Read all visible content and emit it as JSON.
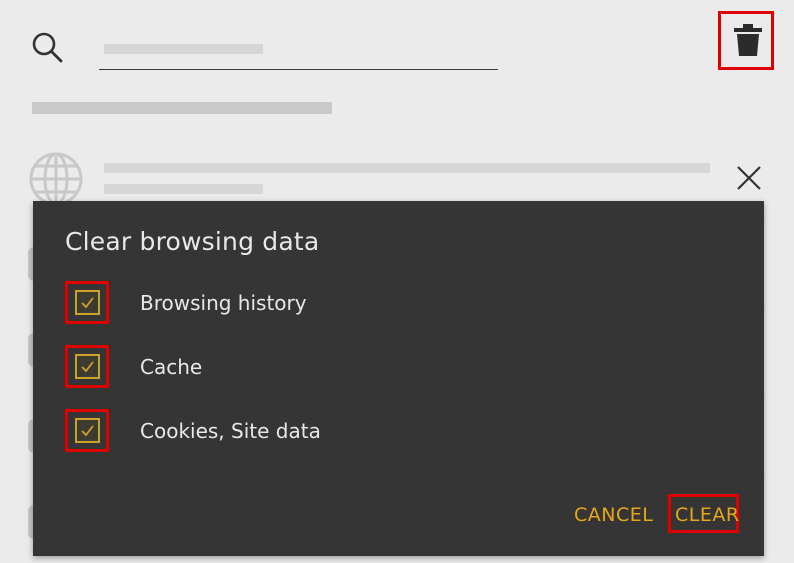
{
  "header": {
    "search_placeholder": "",
    "icons": {
      "search": "search-icon",
      "delete": "trash-icon"
    }
  },
  "history_list": {
    "first_item_icon": "globe-icon",
    "remove_icon": "close-icon"
  },
  "dialog": {
    "title": "Clear browsing data",
    "options": [
      {
        "label": "Browsing history",
        "checked": true
      },
      {
        "label": "Cache",
        "checked": true
      },
      {
        "label": "Cookies, Site data",
        "checked": true
      }
    ],
    "cancel_label": "CANCEL",
    "clear_label": "CLEAR"
  },
  "colors": {
    "accent": "#e7a817",
    "highlight": "#e00000",
    "dialog_bg": "#353535",
    "page_bg": "#ebebeb"
  }
}
